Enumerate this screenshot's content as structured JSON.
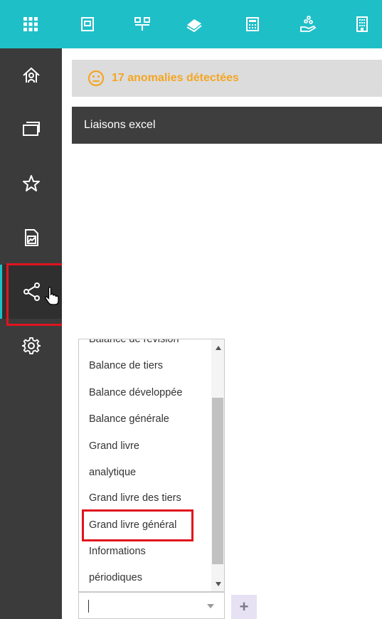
{
  "topbar": {
    "icons": [
      "apps-grid-icon",
      "document-icon",
      "org-chart-icon",
      "money-icon",
      "calculator-icon",
      "hand-coins-icon",
      "building-icon"
    ]
  },
  "sidebar": {
    "items": [
      "home-icon",
      "windows-icon",
      "star-icon",
      "chart-document-icon",
      "share-icon",
      "gear-icon"
    ],
    "active": "share-icon"
  },
  "anomalies": {
    "text": "17 anomalies détectées",
    "icon": "neutral-face-icon",
    "color": "#f5a623"
  },
  "section": {
    "title": "Liaisons excel"
  },
  "dropdown": {
    "items": [
      "Balance de révision",
      "Balance de tiers",
      "Balance développée",
      "Balance générale",
      "Grand livre",
      "analytique",
      "Grand livre des tiers",
      "Grand livre général",
      "Informations",
      "périodiques"
    ],
    "highlighted": "Grand livre général",
    "value": ""
  },
  "colors": {
    "accent": "#1fbfc8",
    "sidebar": "#3b3b3b",
    "highlight": "#e0141e"
  }
}
